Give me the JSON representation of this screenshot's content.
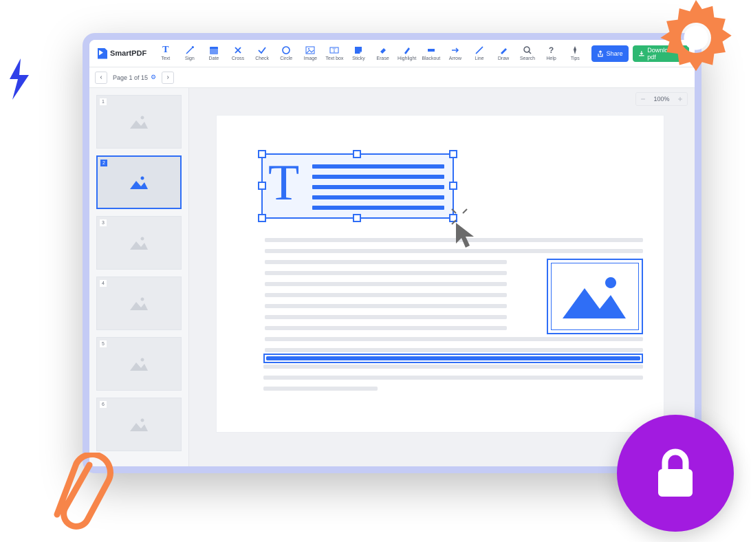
{
  "app": {
    "name": "SmartPDF"
  },
  "toolbar": {
    "tools": [
      {
        "id": "text",
        "label": "Text"
      },
      {
        "id": "sign",
        "label": "Sign"
      },
      {
        "id": "date",
        "label": "Date"
      },
      {
        "id": "cross",
        "label": "Cross"
      },
      {
        "id": "check",
        "label": "Check"
      },
      {
        "id": "circle",
        "label": "Circle"
      },
      {
        "id": "image",
        "label": "Image"
      },
      {
        "id": "textbox",
        "label": "Text box"
      },
      {
        "id": "sticky",
        "label": "Sticky"
      },
      {
        "id": "erase",
        "label": "Erase"
      },
      {
        "id": "highlight",
        "label": "Highlight"
      },
      {
        "id": "blackout",
        "label": "Blackout"
      },
      {
        "id": "arrow",
        "label": "Arrow"
      },
      {
        "id": "line",
        "label": "Line"
      },
      {
        "id": "draw",
        "label": "Draw"
      }
    ],
    "right": [
      {
        "id": "search",
        "label": "Search"
      },
      {
        "id": "help",
        "label": "Help"
      },
      {
        "id": "tips",
        "label": "Tips"
      }
    ],
    "share": "Share",
    "download": "Download pdf"
  },
  "pager": {
    "text": "Page 1 of 15"
  },
  "zoom": {
    "value": "100%"
  },
  "thumbnails": {
    "count": 6,
    "selected": 2
  }
}
